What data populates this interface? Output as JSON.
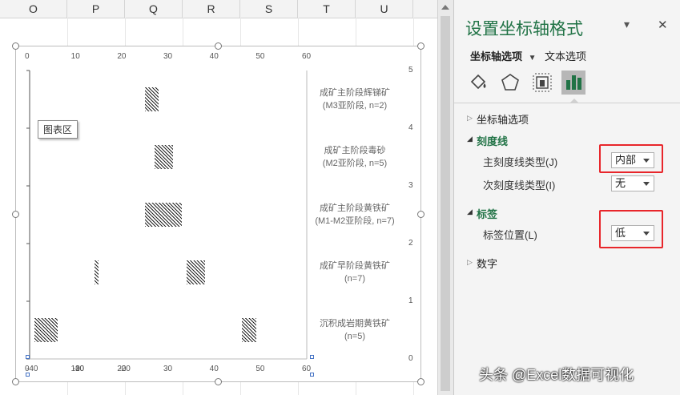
{
  "sheet": {
    "columns": [
      "O",
      "P",
      "Q",
      "R",
      "S",
      "T",
      "U"
    ]
  },
  "chart": {
    "tooltip": "图表区",
    "top_ticks": [
      "0",
      "10",
      "20",
      "30",
      "40",
      "50",
      "60"
    ],
    "bottom_ticks": [
      "-40",
      "-30",
      "-20",
      "-10",
      "-10",
      "0",
      "0",
      "10",
      "20",
      "30",
      "30",
      "40",
      "40",
      "50",
      "50",
      "60"
    ],
    "bottom_tick_display": [
      "-40",
      "-30",
      "-20",
      "-10",
      "0",
      "10",
      "20",
      "30",
      "40",
      "50",
      "60"
    ],
    "right_ticks": [
      "5",
      "4",
      "3",
      "2",
      "1",
      "0"
    ],
    "categories": [
      {
        "line1": "成矿主阶段辉锑矿",
        "line2": "(M3亚阶段, n=2)"
      },
      {
        "line1": "成矿主阶段毒砂",
        "line2": "(M2亚阶段, n=5)"
      },
      {
        "line1": "成矿主阶段黄铁矿",
        "line2": "(M1-M2亚阶段, n=7)"
      },
      {
        "line1": "成矿早阶段黄铁矿",
        "line2": "(n=7)"
      },
      {
        "line1": "沉积成岩期黄铁矿",
        "line2": "(n=5)"
      }
    ]
  },
  "chart_data": {
    "type": "bar",
    "x_range": [
      0,
      60
    ],
    "y_range": [
      0,
      5
    ],
    "bars": [
      {
        "category": "成矿主阶段辉锑矿",
        "x_start": 25,
        "x_end": 28
      },
      {
        "category": "成矿主阶段毒砂",
        "x_start": 27,
        "x_end": 31
      },
      {
        "category": "成矿主阶段黄铁矿",
        "x_start": 25,
        "x_end": 33
      },
      {
        "category": "成矿早阶段黄铁矿",
        "x_start": 14,
        "x_end": 15
      },
      {
        "category": "成矿早阶段黄铁矿",
        "x_start": 34,
        "x_end": 38
      },
      {
        "category": "沉积成岩期黄铁矿",
        "x_start": 1,
        "x_end": 6
      },
      {
        "category": "沉积成岩期黄铁矿",
        "x_start": 46,
        "x_end": 49
      }
    ]
  },
  "panel": {
    "title": "设置坐标轴格式",
    "tab_axis_options": "坐标轴选项",
    "tab_text_options": "文本选项",
    "section_axis_options": "坐标轴选项",
    "section_ticks": "刻度线",
    "major_tick_label": "主刻度线类型(J)",
    "major_tick_value": "内部",
    "minor_tick_label": "次刻度线类型(I)",
    "minor_tick_value": "无",
    "section_labels": "标签",
    "label_position_label": "标签位置(L)",
    "label_position_value": "低",
    "section_number": "数字",
    "close_symbol": "✕",
    "menu_symbol": "⌄"
  },
  "watermark": "头条 @Excel数据可视化"
}
